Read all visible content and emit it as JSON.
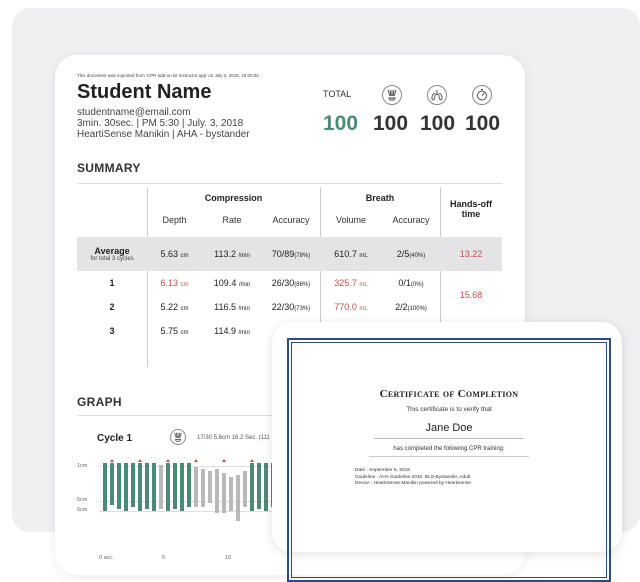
{
  "report": {
    "export_note": "This document was exported from 'CPR add-on kit Instructor app' on July 3, 2018, 18:00:00",
    "student_name": "Student Name",
    "email": "studentname@email.com",
    "session": "3min. 30sec. | PM 5:30 | July. 3, 2018",
    "device": "HeartiSense Manikin | AHA - bystander",
    "total_label": "TOTAL",
    "scores": {
      "total": "100",
      "compression": "100",
      "breath": "100",
      "timing": "100"
    },
    "icons": [
      "compression-hands-icon",
      "lungs-icon",
      "stopwatch-icon"
    ]
  },
  "summary": {
    "title": "SUMMARY",
    "headers": {
      "compression": "Compression",
      "breath": "Breath",
      "hands_off": "Hands-off time",
      "depth": "Depth",
      "rate": "Rate",
      "accuracy": "Accuracy",
      "volume": "Volume",
      "breath_accuracy": "Accuracy"
    },
    "average": {
      "label": "Average",
      "sublabel": "for total 3 cycles",
      "depth": "5.63",
      "depth_unit": "cm",
      "rate": "113.2",
      "rate_unit": "/min",
      "accuracy": "70/89",
      "accuracy_pct": "(78%)",
      "volume": "610.7",
      "volume_unit": "mL",
      "breath_accuracy": "2/5",
      "breath_pct": "(40%)",
      "hands_off": "13.22"
    },
    "rows": [
      {
        "label": "1",
        "depth": "6.13",
        "depth_unit": "cm",
        "rate": "109.4",
        "rate_unit": "/min",
        "accuracy": "26/30",
        "accuracy_pct": "(86%)",
        "volume": "325.7",
        "volume_unit": "mL",
        "breath_accuracy": "0/1",
        "breath_pct": "(0%)"
      },
      {
        "label": "2",
        "depth": "5.22",
        "depth_unit": "cm",
        "rate": "116.5",
        "rate_unit": "/min",
        "accuracy": "22/30",
        "accuracy_pct": "(73%)",
        "volume": "770.0",
        "volume_unit": "mL",
        "breath_accuracy": "2/2",
        "breath_pct": "(100%)"
      },
      {
        "label": "3",
        "depth": "5.75",
        "depth_unit": "cm",
        "rate": "114.9",
        "rate_unit": "/min"
      }
    ],
    "hands_off_rows_1_2": "15.68"
  },
  "graph": {
    "title": "GRAPH",
    "cycle_label": "Cycle 1",
    "cycle_stats": "17/30   5.6cm   16.2 Sec. (111",
    "y_labels": [
      "1cm",
      "5cm",
      "6cm"
    ],
    "x_labels": [
      "0 sec.",
      "5",
      "10"
    ]
  },
  "certificate": {
    "title": "Certificate of Completion",
    "subtitle": "This certificate is to verify that",
    "name": "Jane Doe",
    "completed": "has completed the following CPR training:",
    "date": "Date : September 6, 2018",
    "guideline": "Guideline : AHA Guideline 2015, BLS-Bystander, Adult",
    "device": "Device : HeartiSense Manikin powered by Heartisense"
  },
  "colors": {
    "accent_green": "#4a8a76",
    "alert_red": "#c0504d",
    "bar_gray": "#b9b9bb",
    "frame_blue": "#2c4a86"
  }
}
